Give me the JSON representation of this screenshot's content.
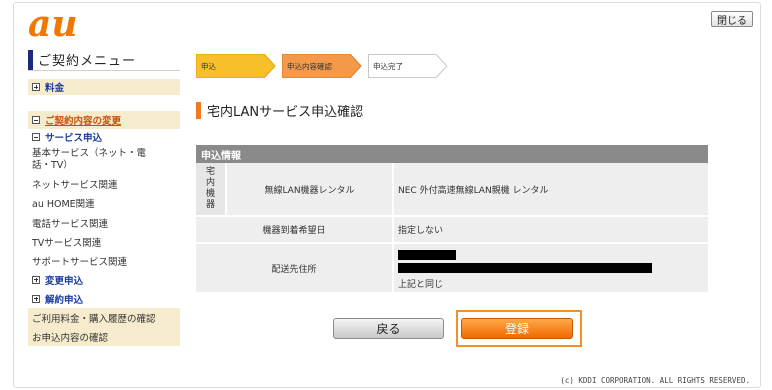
{
  "brand": {
    "logo_text": "au",
    "logo_color": "#ee7800"
  },
  "header": {
    "close_label": "閉じる"
  },
  "sidebar": {
    "title": "ご契約メニュー",
    "items": [
      {
        "label": "料金",
        "kind": "plus"
      },
      {
        "label": "ご契約内容の変更",
        "kind": "minus"
      },
      {
        "label": "サービス申込",
        "kind": "minus"
      },
      {
        "label": "基本サービス（ネット・電話・TV）",
        "kind": "sub"
      },
      {
        "label": "ネットサービス関連",
        "kind": "sub"
      },
      {
        "label": "au HOME関連",
        "kind": "sub"
      },
      {
        "label": "電話サービス関連",
        "kind": "sub"
      },
      {
        "label": "TVサービス関連",
        "kind": "sub"
      },
      {
        "label": "サポートサービス関連",
        "kind": "sub"
      },
      {
        "label": "変更申込",
        "kind": "plus"
      },
      {
        "label": "解約申込",
        "kind": "plus"
      },
      {
        "label": "ご利用料金・購入履歴の確認",
        "kind": "section"
      },
      {
        "label": "お申込内容の確認",
        "kind": "section"
      }
    ]
  },
  "steps": [
    {
      "label": "申込",
      "state": "done",
      "color": "#f7c02a"
    },
    {
      "label": "申込内容確認",
      "state": "current",
      "color": "#f39a4a"
    },
    {
      "label": "申込完了",
      "state": "pending",
      "color": "#ffffff"
    }
  ],
  "page": {
    "title": "宅内LANサービス申込確認",
    "section_header": "申込情報"
  },
  "table": {
    "group_label": "宅内機器",
    "rows": [
      {
        "label": "無線LAN機器レンタル",
        "value": "NEC 外付高速無線LAN親機 レンタル"
      },
      {
        "label": "機器到着希望日",
        "value": "指定しない"
      },
      {
        "label": "配送先住所",
        "value_note": "上記と同じ"
      }
    ]
  },
  "buttons": {
    "back_label": "戻る",
    "register_label": "登録"
  },
  "footer": {
    "copyright": "(c) KDDI CORPORATION. ALL RIGHTS RESERVED."
  }
}
